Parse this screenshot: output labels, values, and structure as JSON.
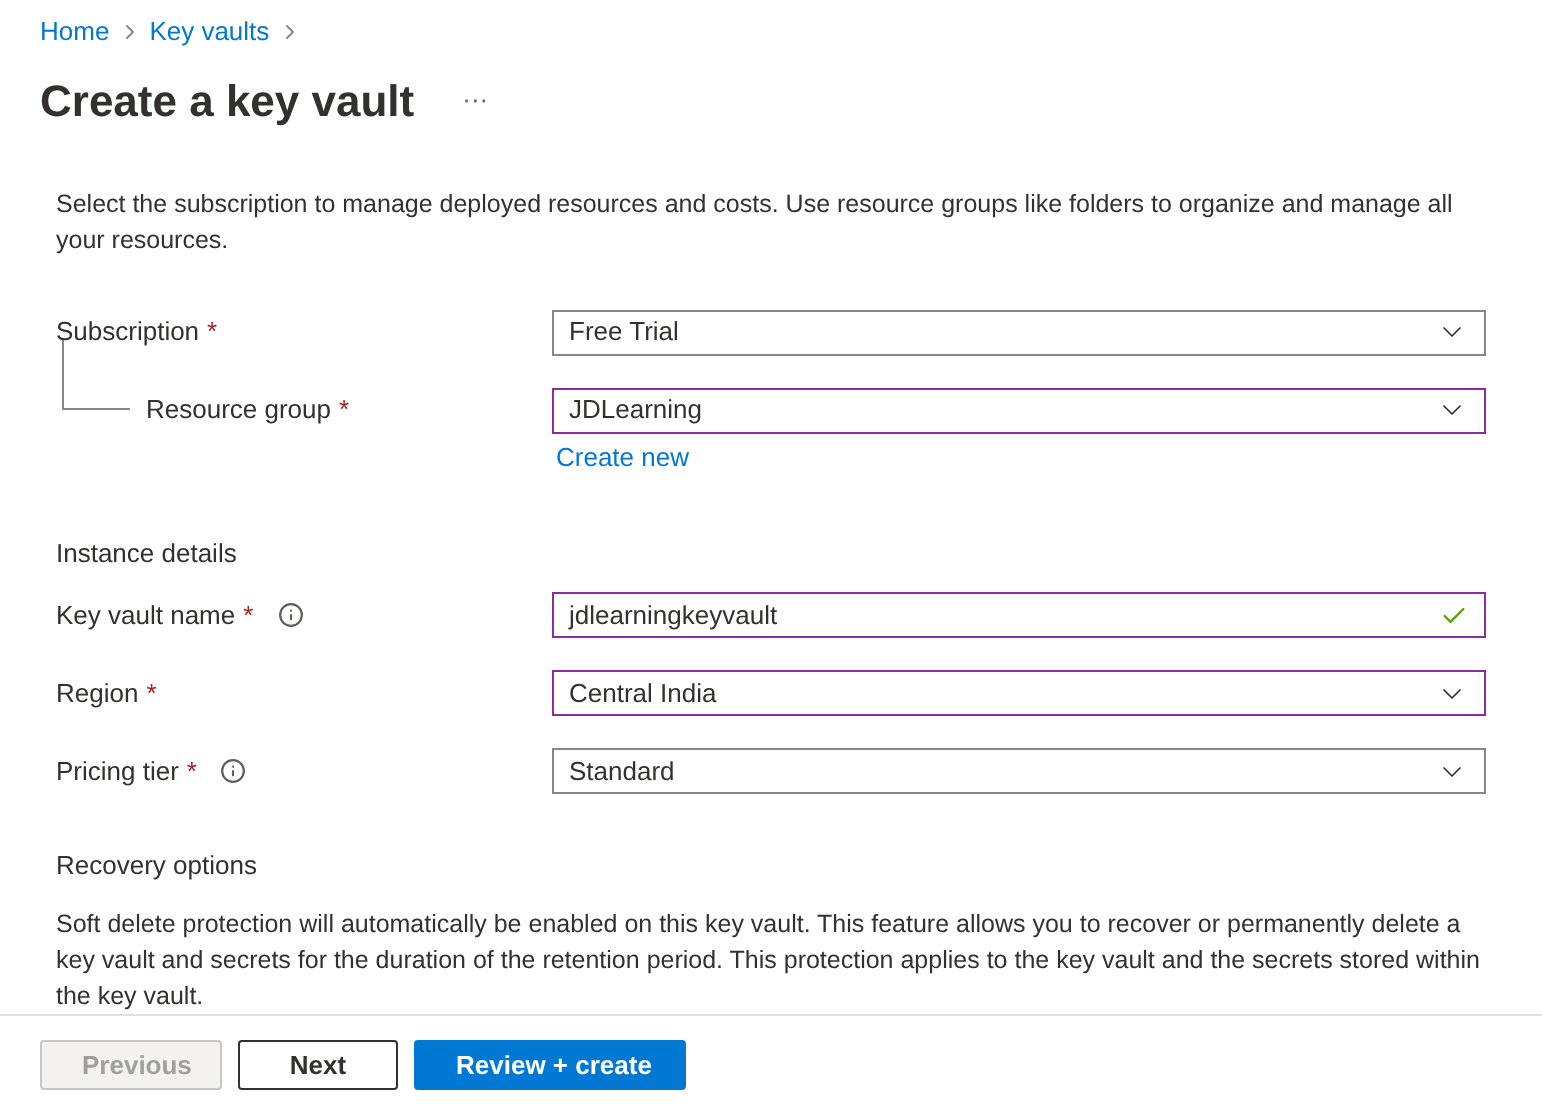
{
  "breadcrumb": [
    {
      "label": "Home"
    },
    {
      "label": "Key vaults"
    }
  ],
  "title": "Create a key vault",
  "more_icon": "···",
  "sections": [
    {
      "description": "Select the subscription to manage deployed resources and costs. Use resource groups like folders to organize and manage all your resources.",
      "fields": [
        {
          "label": "Subscription",
          "required_mark": "*",
          "info": false,
          "kind": "dropdown",
          "value": "Free Trial",
          "modified": false,
          "children": [
            {
              "label": "Resource group",
              "required_mark": "*",
              "info": false,
              "kind": "dropdown",
              "value": "JDLearning",
              "modified": true,
              "link": "Create new"
            }
          ]
        }
      ]
    },
    {
      "heading": "Instance details",
      "fields": [
        {
          "label": "Key vault name",
          "required_mark": "*",
          "info": true,
          "kind": "text",
          "value": "jdlearningkeyvault",
          "modified": true,
          "valid": true
        },
        {
          "label": "Region",
          "required_mark": "*",
          "info": false,
          "kind": "dropdown",
          "value": "Central India",
          "modified": true
        },
        {
          "label": "Pricing tier",
          "required_mark": "*",
          "info": true,
          "kind": "dropdown",
          "value": "Standard",
          "modified": false
        }
      ]
    },
    {
      "heading": "Recovery options",
      "description": "Soft delete protection will automatically be enabled on this key vault. This feature allows you to recover or permanently delete a key vault and secrets for the duration of the retention period. This protection applies to the key vault and the secrets stored within the key vault."
    }
  ],
  "buttons": [
    {
      "label": "Previous",
      "kind": "secondary",
      "disabled": true
    },
    {
      "label": "Next",
      "kind": "secondary",
      "disabled": false
    },
    {
      "label": "Review + create",
      "kind": "primary",
      "disabled": false
    }
  ]
}
